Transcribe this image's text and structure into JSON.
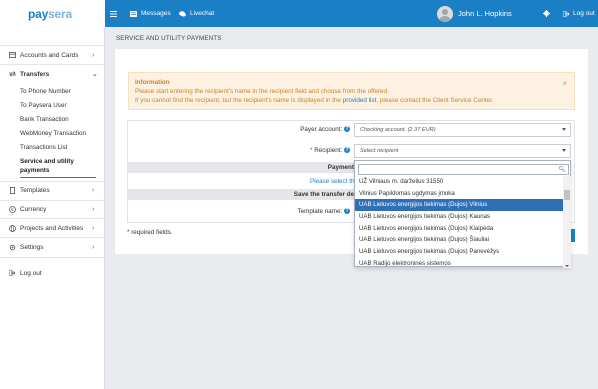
{
  "brand": {
    "logo_a": "pay",
    "logo_b": "sera"
  },
  "topbar": {
    "messages": "Messages",
    "livechat": "Livechat",
    "user_name": "John L. Hopkins",
    "logout": "Log out"
  },
  "sidebar": {
    "accounts": "Accounts and Cards",
    "transfers": "Transfers",
    "sub": [
      "To Phone Number",
      "To Paysera User",
      "Bank Transaction",
      "WebMoney Transaction",
      "Transactions List",
      "Service and utility",
      "payments"
    ],
    "templates": "Templates",
    "currency": "Currency",
    "projects": "Projects and Activities",
    "settings": "Settings",
    "logout": "Log out"
  },
  "page": {
    "title": "SERVICE AND UTILITY PAYMENTS"
  },
  "info": {
    "title": "Information",
    "line1": "Please start entering the recipient's name in the recipient field and choose from the offered.",
    "line2_pre": "If you cannot find the recipient, but the recipient's name is displayed in the ",
    "line2_link": "provided list",
    "line2_post": ", please contact the Client Service Center.",
    "close": "×"
  },
  "form": {
    "payer_label": "Payer account:",
    "payer_value": "Checking account. (2.37 EUR)",
    "recipient_label": "Recipient:",
    "recipient_placeholder": "Select recipient",
    "payment_label": "Payment",
    "please_select": "Please select the",
    "save_transfer": "Save the transfer de",
    "template_label": "Template name:",
    "required_note": "* required fields.",
    "required_star": "*"
  },
  "dropdown": {
    "items": [
      "UŽ Vilniaus m. darželius 31550",
      "Vilnius Papildomas ugdymas įmoka",
      "UAB Lietuvos energijos tiekimas (Dujos) Vilnius",
      "UAB Lietuvos energijos tiekimas (Dujos) Kaunas",
      "UAB Lietuvos energijos tiekimas (Dujos) Klaipėda",
      "UAB Lietuvos energijos tiekimas (Dujos) Šiauliai",
      "UAB Lietuvos energijos tiekimas (Dujos) Panevėžys",
      "UAB Radijo elektroninės sistemos"
    ],
    "selected_index": 2
  },
  "colors": {
    "brand": "#1a7fc5",
    "info_text": "#c8822b",
    "selected": "#2f6fb5"
  }
}
